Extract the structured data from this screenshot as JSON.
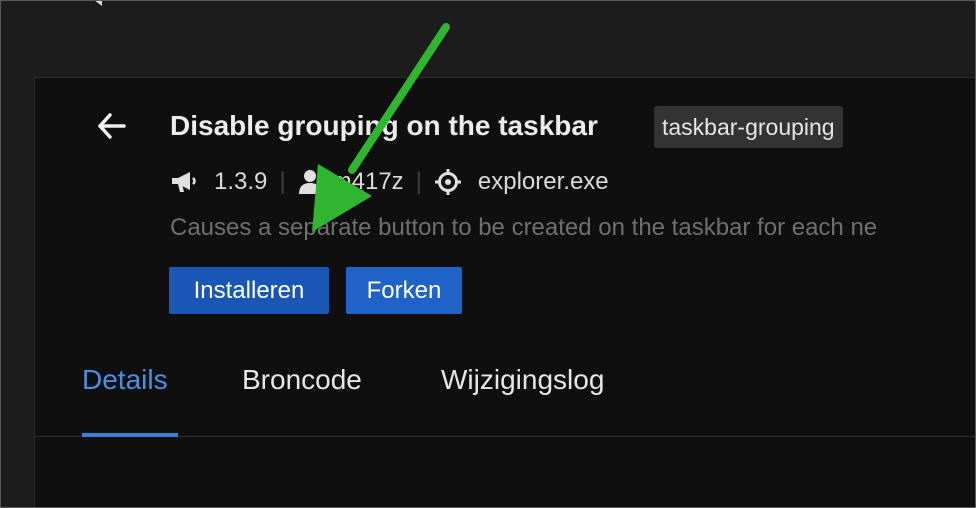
{
  "mod": {
    "title": "Disable grouping on the taskbar",
    "id_tag": "taskbar-grouping",
    "version": "1.3.9",
    "author": "m417z",
    "target_process": "explorer.exe",
    "description": "Causes a separate button to be created on the taskbar for each ne"
  },
  "actions": {
    "install_label": "Installeren",
    "fork_label": "Forken"
  },
  "tabs": [
    {
      "label": "Details",
      "active": true
    },
    {
      "label": "Broncode",
      "active": false
    },
    {
      "label": "Wijzigingslog",
      "active": false
    }
  ],
  "icons": {
    "back": "arrow-left-icon",
    "version": "megaphone-icon",
    "author": "user-icon",
    "process": "crosshair-icon"
  },
  "colors": {
    "accent": "#4a90e2",
    "button": "#1a56b5",
    "annotation_arrow": "#2fb52f"
  }
}
